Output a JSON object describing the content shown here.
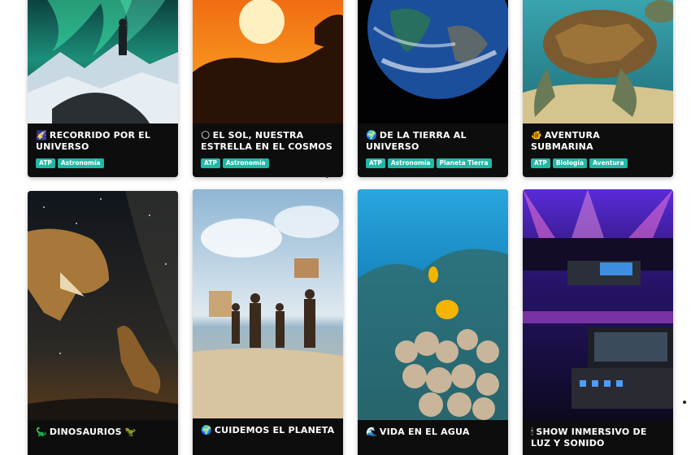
{
  "colors": {
    "tag_bg": "#1fb9a6",
    "card_bg": "#0d0d0d",
    "title_text": "#ffffff"
  },
  "cards": [
    {
      "emoji": "🌠",
      "title": "RECORRIDO POR EL UNIVERSO",
      "tags": [
        "ATP",
        "Astronomía"
      ],
      "image": "aurora-hiker-image"
    },
    {
      "emoji": "🌕",
      "title": "EL SOL, NUESTRA ESTRELLA EN EL COSMOS",
      "tags": [
        "ATP",
        "Astronomía"
      ],
      "image": "sunset-hand-image"
    },
    {
      "emoji": "🌍",
      "title": "DE LA TIERRA AL UNIVERSO",
      "tags": [
        "ATP",
        "Astronomía",
        "Planeta Tierra"
      ],
      "image": "earth-from-space-image"
    },
    {
      "emoji": "🐠",
      "title": "AVENTURA SUBMARINA",
      "tags": [
        "ATP",
        "Biología",
        "Aventura"
      ],
      "image": "sea-turtle-image"
    },
    {
      "emoji": "🦕",
      "title": "DINOSAURIOS",
      "emoji_after": "🦖",
      "tags": [],
      "image": "dinosaurs-night-image"
    },
    {
      "emoji": "🌍",
      "title": "CUIDEMOS EL PLANETA",
      "tags": [],
      "image": "kids-save-earth-image"
    },
    {
      "emoji": "🌊",
      "title": "VIDA EN EL AGUA",
      "tags": [],
      "image": "coral-reef-image"
    },
    {
      "emoji": "🕯",
      "title": "SHOW INMERSIVO DE LUZ Y SONIDO",
      "tags": [],
      "image": "light-show-console-image"
    }
  ]
}
